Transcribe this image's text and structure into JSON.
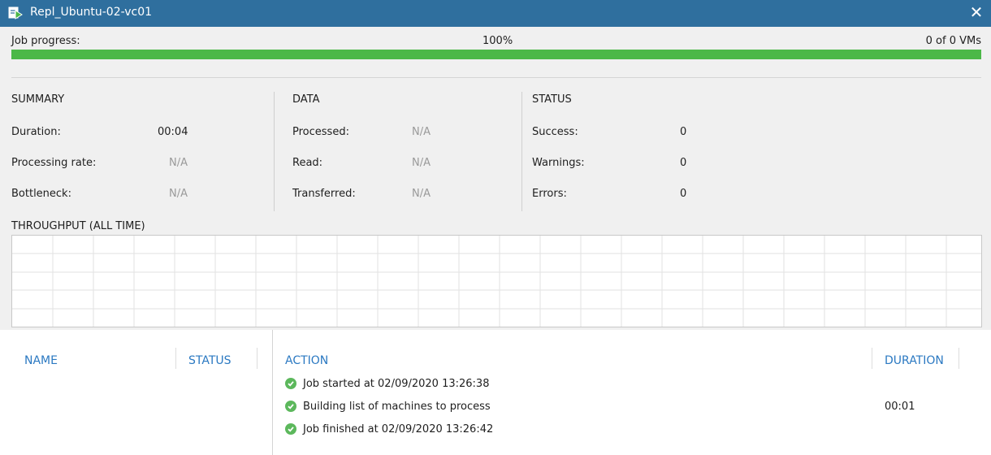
{
  "window": {
    "title": "Repl_Ubuntu-02-vc01",
    "close_label": "✕"
  },
  "progress": {
    "label": "Job progress:",
    "percent_text": "100%",
    "vms_text": "0 of 0 VMs",
    "fraction": 1.0,
    "bar_color": "#4cb848"
  },
  "summary": {
    "heading": "SUMMARY",
    "duration_label": "Duration:",
    "duration_value": "00:04",
    "rate_label": "Processing rate:",
    "rate_value": "N/A",
    "bottleneck_label": "Bottleneck:",
    "bottleneck_value": "N/A"
  },
  "data_section": {
    "heading": "DATA",
    "processed_label": "Processed:",
    "processed_value": "N/A",
    "read_label": "Read:",
    "read_value": "N/A",
    "transferred_label": "Transferred:",
    "transferred_value": "N/A"
  },
  "status": {
    "heading": "STATUS",
    "success_label": "Success:",
    "success_value": "0",
    "warnings_label": "Warnings:",
    "warnings_value": "0",
    "errors_label": "Errors:",
    "errors_value": "0"
  },
  "throughput": {
    "heading": "THROUGHPUT (ALL TIME)"
  },
  "log": {
    "columns": {
      "name": "NAME",
      "status": "STATUS",
      "action": "ACTION",
      "duration": "DURATION"
    },
    "rows": [
      {
        "action": "Job started at 02/09/2020 13:26:38",
        "duration": ""
      },
      {
        "action": "Building list of machines to process",
        "duration": "00:01"
      },
      {
        "action": "Job finished at 02/09/2020 13:26:42",
        "duration": ""
      }
    ]
  },
  "colors": {
    "titlebar": "#2f6f9e",
    "accent_text": "#2b79c2",
    "success_icon": "#5cb85c"
  }
}
